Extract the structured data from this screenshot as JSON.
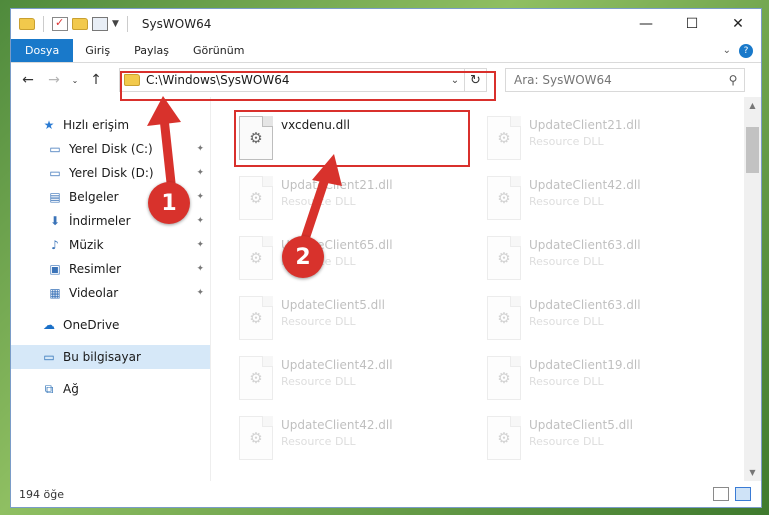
{
  "window": {
    "title": "SysWOW64",
    "controls": {
      "minimize": "—",
      "maximize": "☐",
      "close": "✕"
    }
  },
  "ribbon": {
    "tabs": [
      "Dosya",
      "Giriş",
      "Paylaş",
      "Görünüm"
    ],
    "help_chevron": "⌄"
  },
  "nav": {
    "back": "←",
    "forward": "→",
    "recent": "⌄",
    "up": "↑",
    "address_path": "C:\\Windows\\SysWOW64",
    "address_chevron": "⌄",
    "refresh": "↻",
    "search_placeholder": "Ara: SysWOW64",
    "search_icon": "⚲"
  },
  "sidebar": {
    "quick_access": "Hızlı erişim",
    "items": [
      {
        "label": "Yerel Disk (C:)",
        "icon": "drive-icon",
        "glyph": "▭",
        "pinned": true
      },
      {
        "label": "Yerel Disk (D:)",
        "icon": "drive-icon",
        "glyph": "▭",
        "pinned": true
      },
      {
        "label": "Belgeler",
        "icon": "documents-icon",
        "glyph": "▤",
        "pinned": true
      },
      {
        "label": "İndirmeler",
        "icon": "downloads-icon",
        "glyph": "⬇",
        "pinned": true
      },
      {
        "label": "Müzik",
        "icon": "music-icon",
        "glyph": "♪",
        "pinned": true
      },
      {
        "label": "Resimler",
        "icon": "pictures-icon",
        "glyph": "▣",
        "pinned": true
      },
      {
        "label": "Videolar",
        "icon": "videos-icon",
        "glyph": "▦",
        "pinned": true
      }
    ],
    "onedrive": "OneDrive",
    "this_pc": "Bu bilgisayar",
    "network": "Ağ",
    "pin_glyph": "📌"
  },
  "files": [
    {
      "name": "vxcdenu.dll",
      "type": "",
      "faded": false
    },
    {
      "name": "UpdateClient21.dll",
      "type": "Resource DLL",
      "faded": true
    },
    {
      "name": "UpdateClient21.dll",
      "type": "Resource DLL",
      "faded": true
    },
    {
      "name": "UpdateClient42.dll",
      "type": "Resource DLL",
      "faded": true
    },
    {
      "name": "UpdateClient65.dll",
      "type": "Resource DLL",
      "faded": true
    },
    {
      "name": "UpdateClient63.dll",
      "type": "Resource DLL",
      "faded": true
    },
    {
      "name": "UpdateClient5.dll",
      "type": "Resource DLL",
      "faded": true
    },
    {
      "name": "UpdateClient63.dll",
      "type": "Resource DLL",
      "faded": true
    },
    {
      "name": "UpdateClient42.dll",
      "type": "Resource DLL",
      "faded": true
    },
    {
      "name": "UpdateClient19.dll",
      "type": "Resource DLL",
      "faded": true
    },
    {
      "name": "UpdateClient42.dll",
      "type": "Resource DLL",
      "faded": true
    },
    {
      "name": "UpdateClient5.dll",
      "type": "Resource DLL",
      "faded": true
    }
  ],
  "status": {
    "item_count": "194 öğe"
  },
  "annotations": {
    "badge_1": "1",
    "badge_2": "2",
    "color": "#d8322c"
  }
}
